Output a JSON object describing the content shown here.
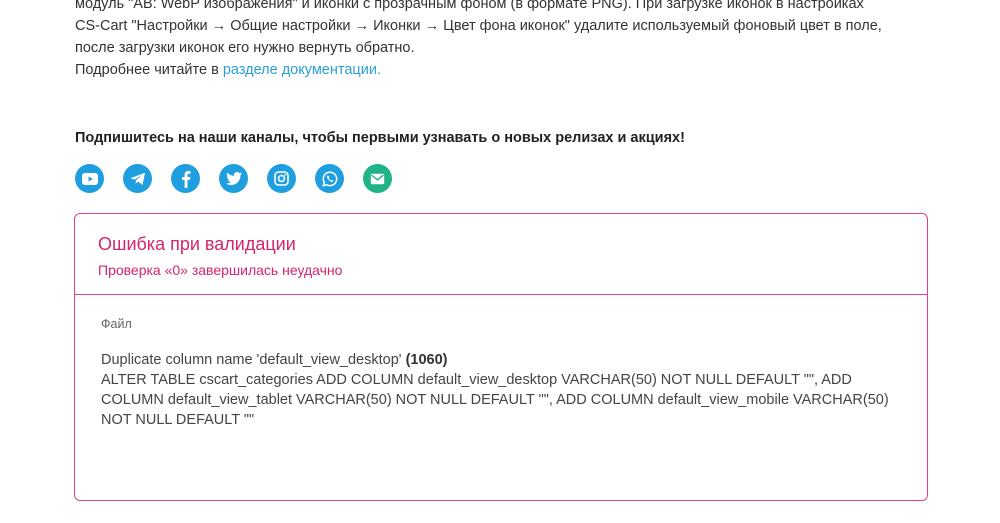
{
  "intro": {
    "line1": "модуль \"AB: WebP изображения\" и иконки с прозрачным фоном (в формате PNG). При загрузке иконок в настройках",
    "line2": "CS-Cart \"Настройки → Общие настройки → Иконки → Цвет фона иконок\" удалите используемый фоновый цвет в поле,",
    "line3": "после загрузки иконок его нужно вернуть обратно.",
    "line4_prefix": "Подробнее читайте в ",
    "line4_link": "разделе документации."
  },
  "subscribe": {
    "heading": "Подпишитесь на наши каналы, чтобы первыми узнавать о новых релизах и акциях!",
    "channels": [
      {
        "name": "youtube-icon",
        "color": "#1f9fe0"
      },
      {
        "name": "telegram-icon",
        "color": "#1f9fe0"
      },
      {
        "name": "facebook-icon",
        "color": "#1f9fe0"
      },
      {
        "name": "twitter-icon",
        "color": "#1f9fe0"
      },
      {
        "name": "instagram-icon",
        "color": "#1f9fe0"
      },
      {
        "name": "whatsapp-icon",
        "color": "#1f9fe0"
      },
      {
        "name": "email-icon",
        "color": "#20b387"
      }
    ]
  },
  "error": {
    "title": "Ошибка при валидации",
    "subtitle": "Проверка «0» завершилась неудачно",
    "file_label": "Файл",
    "message": "Duplicate column name 'default_view_desktop' ",
    "code": "(1060)",
    "sql": "ALTER TABLE cscart_categories ADD COLUMN default_view_desktop VARCHAR(50) NOT NULL DEFAULT \"\", ADD COLUMN default_view_tablet VARCHAR(50) NOT NULL DEFAULT \"\", ADD COLUMN default_view_mobile VARCHAR(50) NOT NULL DEFAULT \"\"",
    "accent_color": "#d6246e"
  }
}
